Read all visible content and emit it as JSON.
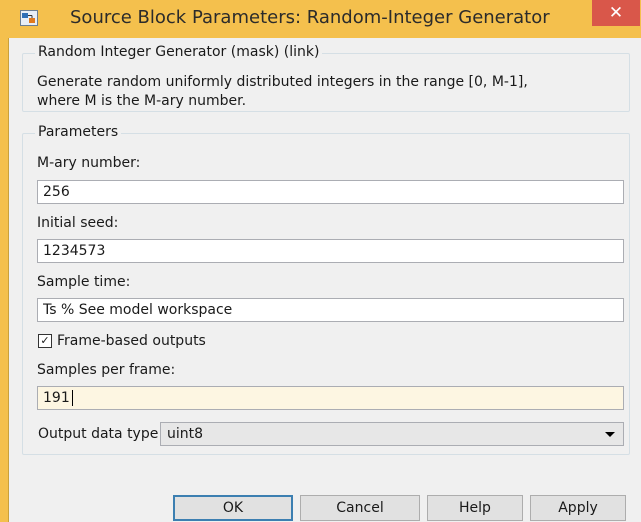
{
  "window": {
    "title": "Source Block Parameters: Random-Integer Generator",
    "close_label": "✕"
  },
  "block": {
    "header": "Random Integer Generator (mask) (link)",
    "description_line1": "Generate random uniformly distributed integers in the range [0, M-1],",
    "description_line2": "where M is the M-ary number."
  },
  "parameters": {
    "group_label": "Parameters",
    "mary_label": "M-ary number:",
    "mary_value": "256",
    "seed_label": "Initial seed:",
    "seed_value": "1234573",
    "sample_time_label": "Sample time:",
    "sample_time_value": "Ts % See model workspace",
    "frame_based_label": "Frame-based outputs",
    "frame_based_checked": true,
    "samples_per_frame_label": "Samples per frame:",
    "samples_per_frame_value": "191",
    "output_type_label": "Output data type:",
    "output_type_value": "uint8"
  },
  "buttons": {
    "ok": "OK",
    "cancel": "Cancel",
    "help": "Help",
    "apply": "Apply"
  },
  "colors": {
    "titlebar": "#f4c04d",
    "close": "#d9574a",
    "active_field": "#fdf6e2"
  }
}
